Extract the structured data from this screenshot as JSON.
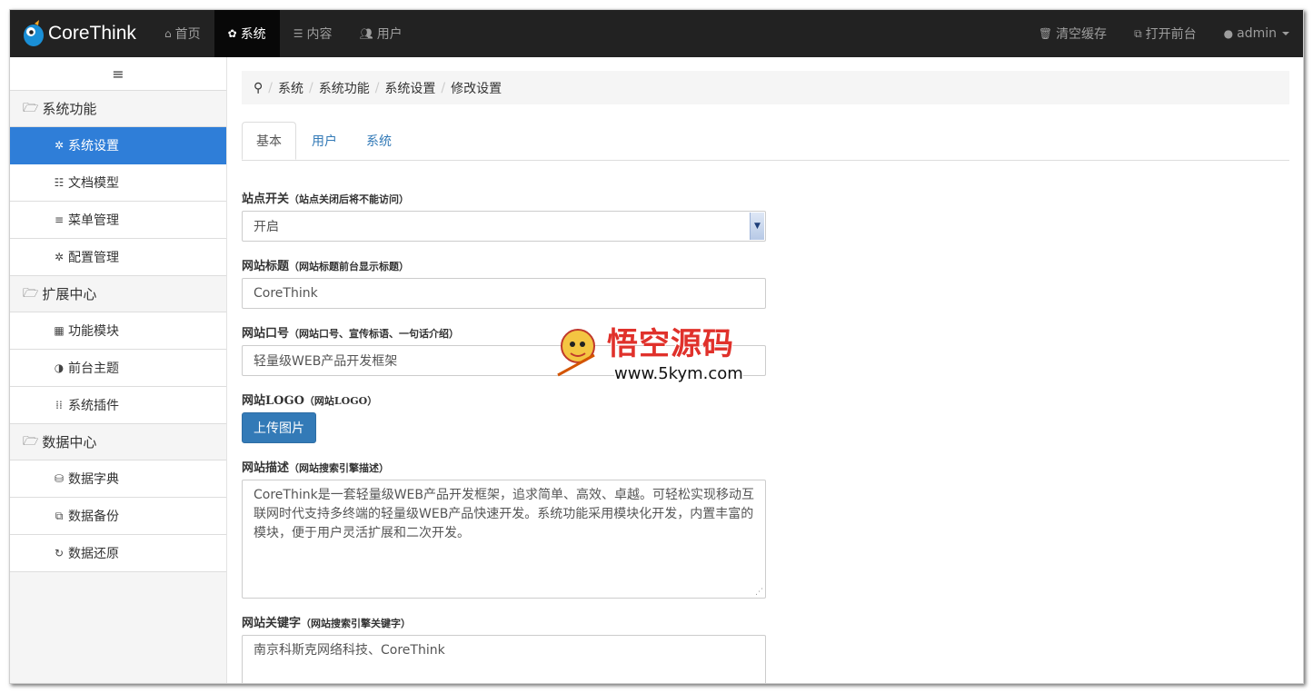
{
  "brand": {
    "name": "CoreThink",
    "accent": "#1a8fd6"
  },
  "nav": {
    "left": [
      {
        "label": "首页",
        "icon": "home-icon",
        "active": false
      },
      {
        "label": "系统",
        "icon": "gear-icon",
        "active": true
      },
      {
        "label": "内容",
        "icon": "list-icon",
        "active": false
      },
      {
        "label": "用户",
        "icon": "users-icon",
        "active": false
      }
    ],
    "right": [
      {
        "label": "清空缓存",
        "icon": "trash-icon"
      },
      {
        "label": "打开前台",
        "icon": "external-link-icon"
      },
      {
        "label": "admin",
        "icon": "user-icon"
      }
    ]
  },
  "sidebar": {
    "toggle_icon": "menu-icon",
    "groups": [
      {
        "label": "系统功能",
        "items": [
          "系统设置",
          "文档模型",
          "菜单管理",
          "配置管理"
        ]
      },
      {
        "label": "扩展中心",
        "items": [
          "功能模块",
          "前台主题",
          "系统插件"
        ]
      },
      {
        "label": "数据中心",
        "items": [
          "数据字典",
          "数据备份",
          "数据还原"
        ]
      }
    ],
    "active_item": "系统设置"
  },
  "breadcrumb": {
    "icon": "map-marker-icon",
    "items": [
      "系统",
      "系统功能",
      "系统设置",
      "修改设置"
    ]
  },
  "tabs": [
    "基本",
    "用户",
    "系统"
  ],
  "form": {
    "site_switch": {
      "label": "站点开关",
      "hint": "（站点关闭后将不能访问）",
      "value": "开启"
    },
    "site_title": {
      "label": "网站标题",
      "hint": "（网站标题前台显示标题）",
      "value": "CoreThink"
    },
    "site_slogan": {
      "label": "网站口号",
      "hint": "（网站口号、宣传标语、一句话介绍）",
      "value": "轻量级WEB产品开发框架"
    },
    "site_logo": {
      "label": "网站LOGO",
      "hint": "（网站LOGO）",
      "button": "上传图片"
    },
    "site_description": {
      "label": "网站描述",
      "hint": "（网站搜索引擎描述）",
      "lines": [
        "CoreThink是一套轻量级WEB产品开发框架，追求简单、高效、卓越。可轻松实现移动互",
        "联网时代支持多终端的轻量级WEB产品快速开发。系统功能采用模块化开发，内置丰富的",
        "模块，便于用户灵活扩展和二次开发。"
      ]
    },
    "site_keywords": {
      "label": "网站关键字",
      "hint": "（网站搜索引擎关键字）",
      "value": "南京科斯克网络科技、CoreThink"
    }
  },
  "watermark": {
    "title": "悟空源码",
    "url": "www.5kym.com"
  }
}
